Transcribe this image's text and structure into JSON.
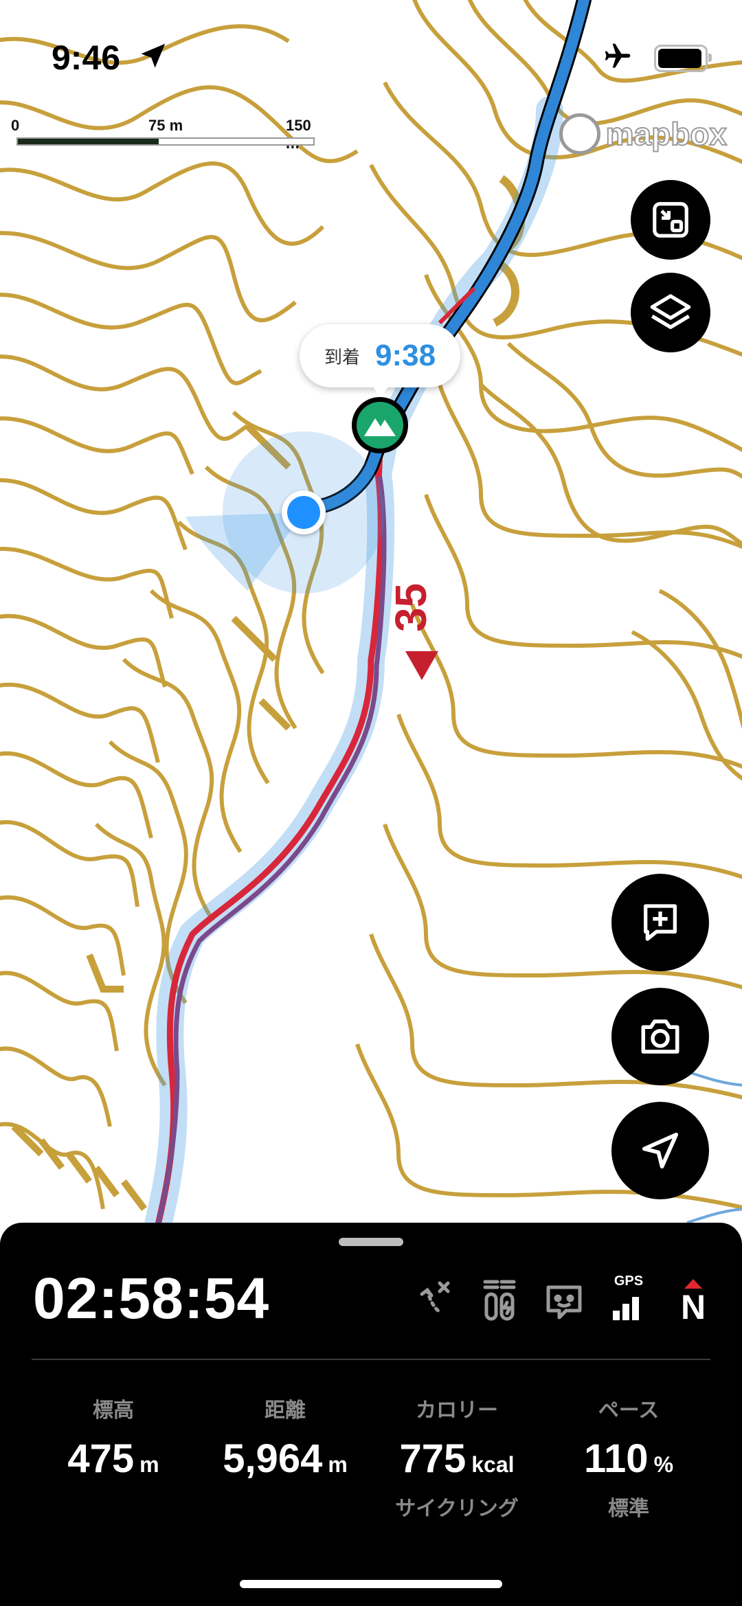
{
  "status_bar": {
    "time": "9:46"
  },
  "scale": {
    "labels": [
      "0",
      "75 m",
      "150 m"
    ]
  },
  "map": {
    "attribution": "mapbox",
    "contour_label": "35",
    "arrival_label": "到着",
    "arrival_time": "9:38",
    "colors": {
      "contour": "#c7a03c",
      "route": "#2f86d6",
      "track": "#d8263a"
    }
  },
  "panel": {
    "elapsed_time": "02:58:54",
    "status_icons": [
      "route-off-icon",
      "battery-saver-icon",
      "chat-icon",
      "gps-signal-icon",
      "compass-north-icon"
    ],
    "gps_label": "GPS",
    "north_label": "N",
    "stats": [
      {
        "label": "標高",
        "value": "475",
        "unit": "m",
        "sub": ""
      },
      {
        "label": "距離",
        "value": "5,964",
        "unit": "m",
        "sub": ""
      },
      {
        "label": "カロリー",
        "value": "775",
        "unit": "kcal",
        "sub": "サイクリング"
      },
      {
        "label": "ペース",
        "value": "110",
        "unit": "%",
        "sub": "標準"
      }
    ]
  }
}
